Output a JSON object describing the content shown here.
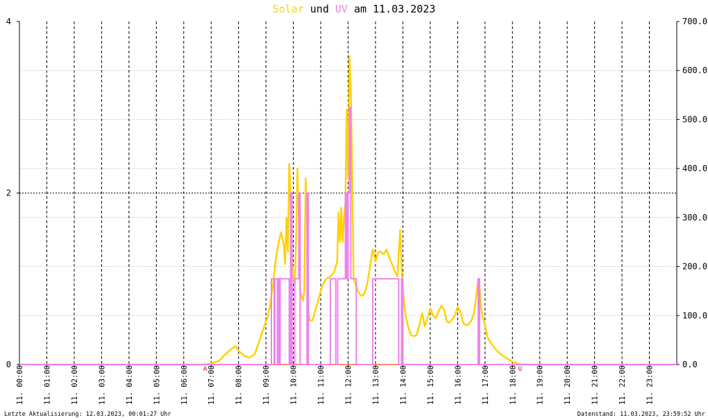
{
  "title": {
    "solar_word": "Solar",
    "und": "und",
    "uv_word": "UV",
    "am": "am",
    "date": "11.03.2023"
  },
  "footer": {
    "left": "Letzte Aktualisierung: 12.03.2023, 00:01:27 Uhr",
    "right": "Datenstand: 11.03.2023, 23:59:52 Uhr"
  },
  "chart_data": {
    "type": "line",
    "title": "Solar und UV am 11.03.2023",
    "x_range_hours": [
      0,
      24
    ],
    "x_ticks": [
      "11. 00:00",
      "11. 01:00",
      "11. 02:00",
      "11. 03:00",
      "11. 04:00",
      "11. 05:00",
      "11. 06:00",
      "11. 07:00",
      "11. 08:00",
      "11. 09:00",
      "11. 10:00",
      "11. 11:00",
      "11. 12:00",
      "11. 13:00",
      "11. 14:00",
      "11. 15:00",
      "11. 16:00",
      "11. 17:00",
      "11. 18:00",
      "11. 19:00",
      "11. 20:00",
      "11. 21:00",
      "11. 22:00",
      "11. 23:00"
    ],
    "y_left": {
      "range": [
        0,
        4
      ],
      "ticks": [
        "0",
        "2",
        "4"
      ],
      "label": "UV"
    },
    "y_right": {
      "range": [
        0,
        700
      ],
      "ticks": [
        "0.0",
        "100.0",
        "200.0",
        "300.0",
        "400.0",
        "500.0",
        "600.0",
        "700.0"
      ],
      "label": "Solar"
    },
    "grid": true,
    "markers": [
      {
        "label": "A",
        "hour": 6.78
      },
      {
        "label": "U",
        "hour": 18.28
      }
    ],
    "colors": {
      "solar": "#ffd200",
      "uv": "#ee82ee",
      "baseline": "#f48c6c",
      "grid": "#000000",
      "marker": "#cc0000"
    },
    "series": [
      {
        "name": "Solar",
        "axis": "right",
        "points": [
          [
            0,
            0
          ],
          [
            6.7,
            0
          ],
          [
            6.9,
            1
          ],
          [
            7.1,
            4
          ],
          [
            7.3,
            8
          ],
          [
            7.5,
            20
          ],
          [
            7.7,
            30
          ],
          [
            7.9,
            38
          ],
          [
            8.0,
            28
          ],
          [
            8.2,
            18
          ],
          [
            8.4,
            14
          ],
          [
            8.6,
            22
          ],
          [
            8.8,
            55
          ],
          [
            8.95,
            80
          ],
          [
            9.05,
            95
          ],
          [
            9.15,
            120
          ],
          [
            9.25,
            160
          ],
          [
            9.35,
            210
          ],
          [
            9.45,
            245
          ],
          [
            9.55,
            270
          ],
          [
            9.65,
            245
          ],
          [
            9.7,
            205
          ],
          [
            9.75,
            300
          ],
          [
            9.8,
            230
          ],
          [
            9.85,
            410
          ],
          [
            9.9,
            340
          ],
          [
            9.95,
            210
          ],
          [
            10.0,
            180
          ],
          [
            10.05,
            160
          ],
          [
            10.1,
            250
          ],
          [
            10.15,
            400
          ],
          [
            10.2,
            300
          ],
          [
            10.25,
            150
          ],
          [
            10.3,
            140
          ],
          [
            10.35,
            130
          ],
          [
            10.4,
            150
          ],
          [
            10.45,
            380
          ],
          [
            10.5,
            300
          ],
          [
            10.55,
            110
          ],
          [
            10.6,
            90
          ],
          [
            10.7,
            90
          ],
          [
            10.8,
            110
          ],
          [
            10.9,
            130
          ],
          [
            11.0,
            150
          ],
          [
            11.1,
            165
          ],
          [
            11.2,
            175
          ],
          [
            11.3,
            178
          ],
          [
            11.4,
            182
          ],
          [
            11.5,
            190
          ],
          [
            11.6,
            210
          ],
          [
            11.65,
            310
          ],
          [
            11.7,
            250
          ],
          [
            11.75,
            320
          ],
          [
            11.8,
            250
          ],
          [
            11.85,
            300
          ],
          [
            11.9,
            330
          ],
          [
            11.95,
            520
          ],
          [
            12.0,
            380
          ],
          [
            12.05,
            630
          ],
          [
            12.1,
            560
          ],
          [
            12.15,
            400
          ],
          [
            12.2,
            175
          ],
          [
            12.3,
            160
          ],
          [
            12.4,
            145
          ],
          [
            12.5,
            140
          ],
          [
            12.6,
            145
          ],
          [
            12.7,
            165
          ],
          [
            12.8,
            200
          ],
          [
            12.9,
            235
          ],
          [
            13.0,
            210
          ],
          [
            13.1,
            230
          ],
          [
            13.2,
            230
          ],
          [
            13.3,
            225
          ],
          [
            13.4,
            235
          ],
          [
            13.5,
            220
          ],
          [
            13.6,
            205
          ],
          [
            13.7,
            190
          ],
          [
            13.8,
            180
          ],
          [
            13.9,
            275
          ],
          [
            13.95,
            200
          ],
          [
            14.0,
            150
          ],
          [
            14.1,
            100
          ],
          [
            14.2,
            75
          ],
          [
            14.3,
            60
          ],
          [
            14.4,
            58
          ],
          [
            14.5,
            60
          ],
          [
            14.6,
            80
          ],
          [
            14.7,
            105
          ],
          [
            14.8,
            78
          ],
          [
            14.9,
            95
          ],
          [
            15.0,
            115
          ],
          [
            15.1,
            100
          ],
          [
            15.2,
            95
          ],
          [
            15.3,
            108
          ],
          [
            15.4,
            120
          ],
          [
            15.5,
            112
          ],
          [
            15.6,
            88
          ],
          [
            15.7,
            85
          ],
          [
            15.8,
            92
          ],
          [
            15.9,
            100
          ],
          [
            16.0,
            118
          ],
          [
            16.1,
            108
          ],
          [
            16.2,
            85
          ],
          [
            16.3,
            80
          ],
          [
            16.4,
            82
          ],
          [
            16.5,
            90
          ],
          [
            16.6,
            105
          ],
          [
            16.7,
            150
          ],
          [
            16.75,
            175
          ],
          [
            16.8,
            160
          ],
          [
            16.85,
            120
          ],
          [
            16.9,
            100
          ],
          [
            17.0,
            80
          ],
          [
            17.1,
            55
          ],
          [
            17.2,
            45
          ],
          [
            17.3,
            38
          ],
          [
            17.4,
            30
          ],
          [
            17.6,
            20
          ],
          [
            17.8,
            12
          ],
          [
            18.0,
            6
          ],
          [
            18.2,
            2
          ],
          [
            18.3,
            0
          ],
          [
            24,
            0
          ]
        ]
      },
      {
        "name": "UV",
        "axis": "left",
        "points": [
          [
            0,
            0
          ],
          [
            9.2,
            0
          ],
          [
            9.2,
            1
          ],
          [
            9.3,
            1
          ],
          [
            9.3,
            0
          ],
          [
            9.32,
            0
          ],
          [
            9.32,
            1
          ],
          [
            9.42,
            1
          ],
          [
            9.42,
            0
          ],
          [
            9.45,
            0
          ],
          [
            9.45,
            1
          ],
          [
            9.5,
            1
          ],
          [
            9.5,
            0
          ],
          [
            9.52,
            0
          ],
          [
            9.52,
            1
          ],
          [
            9.85,
            1
          ],
          [
            9.85,
            0
          ],
          [
            9.9,
            0
          ],
          [
            9.9,
            2
          ],
          [
            9.95,
            2
          ],
          [
            9.95,
            0
          ],
          [
            10.05,
            0
          ],
          [
            10.05,
            1
          ],
          [
            10.2,
            1
          ],
          [
            10.2,
            2
          ],
          [
            10.25,
            2
          ],
          [
            10.25,
            0
          ],
          [
            10.5,
            0
          ],
          [
            10.5,
            2
          ],
          [
            10.55,
            2
          ],
          [
            10.55,
            0
          ],
          [
            11.35,
            0
          ],
          [
            11.35,
            1
          ],
          [
            11.55,
            1
          ],
          [
            11.55,
            0
          ],
          [
            11.62,
            0
          ],
          [
            11.62,
            1
          ],
          [
            11.9,
            1
          ],
          [
            11.9,
            2
          ],
          [
            11.95,
            2
          ],
          [
            11.95,
            1
          ],
          [
            12.0,
            1
          ],
          [
            12.0,
            2
          ],
          [
            12.05,
            2
          ],
          [
            12.05,
            3
          ],
          [
            12.1,
            3
          ],
          [
            12.1,
            1
          ],
          [
            12.3,
            1
          ],
          [
            12.3,
            0
          ],
          [
            12.9,
            0
          ],
          [
            12.9,
            1
          ],
          [
            13.85,
            1
          ],
          [
            13.85,
            0
          ],
          [
            13.95,
            0
          ],
          [
            13.95,
            1
          ],
          [
            14.0,
            1
          ],
          [
            14.0,
            0
          ],
          [
            16.75,
            0
          ],
          [
            16.75,
            1
          ],
          [
            16.8,
            1
          ],
          [
            16.8,
            0
          ],
          [
            24,
            0
          ]
        ]
      }
    ]
  }
}
